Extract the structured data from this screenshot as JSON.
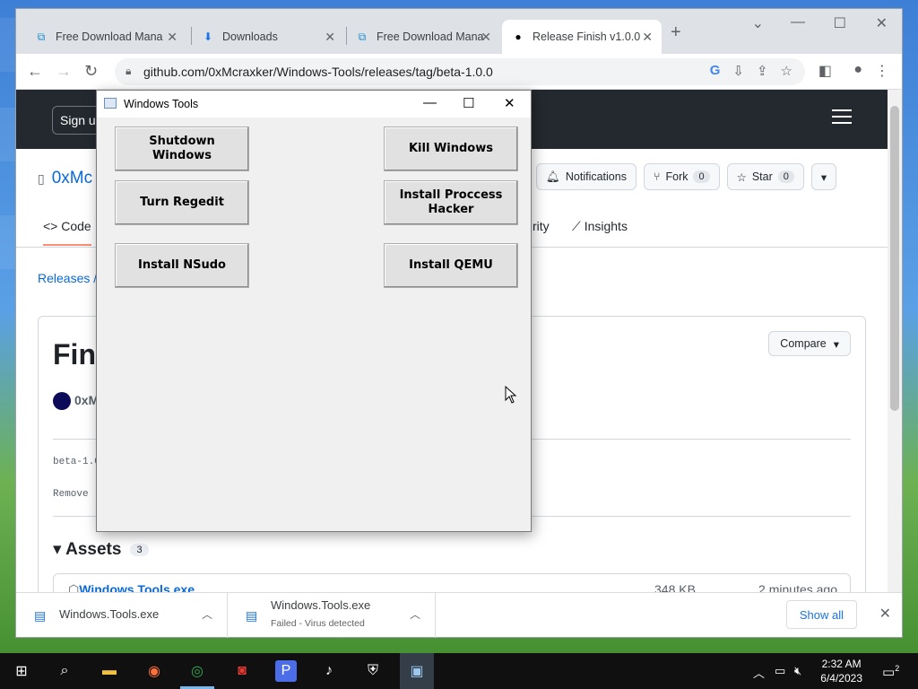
{
  "browser": {
    "tabs": [
      {
        "label": "Free Download Mana",
        "icon": "fdm-icon"
      },
      {
        "label": "Downloads",
        "icon": "download-icon"
      },
      {
        "label": "Free Download Mana",
        "icon": "fdm-icon"
      },
      {
        "label": "Release Finish v1.0.0",
        "icon": "github-icon"
      }
    ],
    "url": "github.com/0xMcraxker/Windows-Tools/releases/tag/beta-1.0.0"
  },
  "github": {
    "signup": "Sign u",
    "repo_name": "0xMc",
    "notifications": "Notifications",
    "fork_label": "Fork",
    "fork_count": "0",
    "star_label": "Star",
    "star_count": "0",
    "tab_code": "Code",
    "tab_security": "rity",
    "tab_insights": "Insights",
    "breadcrumb": "Releases /",
    "release_title": "Fini",
    "compare": "Compare",
    "author": "0xM",
    "tag_text": "beta-1.0",
    "remove_text": "Remove",
    "assets_label": "Assets",
    "assets_count": "3",
    "asset_name": "Windows.Tools.exe",
    "asset_size": "348 KB",
    "asset_time": "2 minutes ago"
  },
  "downloads": [
    {
      "name": "Windows.Tools.exe",
      "status": ""
    },
    {
      "name": "Windows.Tools.exe",
      "status": "Failed - Virus detected"
    }
  ],
  "show_all": "Show all",
  "dialog": {
    "title": "Windows Tools",
    "buttons": {
      "shutdown": "Shutdown Windows",
      "kill": "Kill Windows",
      "regedit": "Turn Regedit",
      "process_hacker": "Install Proccess Hacker",
      "nsudo": "Install NSudo",
      "qemu": "Install QEMU"
    }
  },
  "taskbar": {
    "time": "2:32 AM",
    "date": "6/4/2023",
    "notifications_count": "2"
  }
}
